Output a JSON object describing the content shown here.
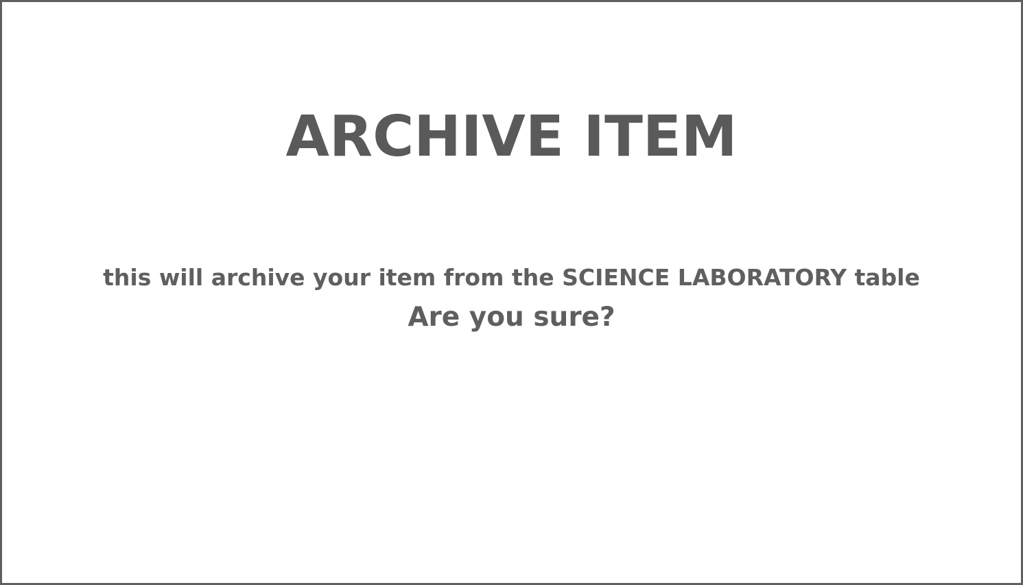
{
  "dialog": {
    "title": "ARCHIVE ITEM",
    "message": "this will archive your item from the SCIENCE LABORATORY table",
    "question": "Are you sure?"
  },
  "colors": {
    "text": "#5a5a5a",
    "border": "#5f5f5f",
    "background": "#ffffff"
  }
}
